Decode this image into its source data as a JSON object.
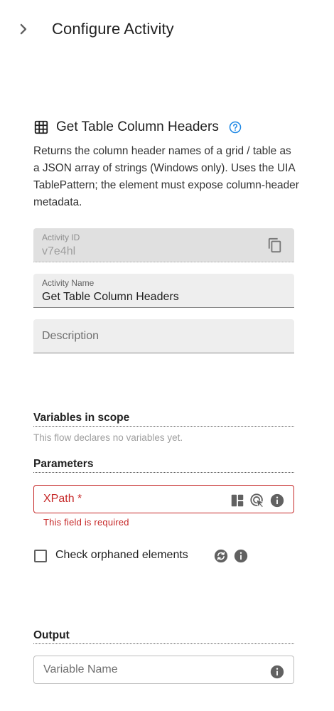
{
  "header": {
    "title": "Configure Activity",
    "back_icon": "chevron-right-icon"
  },
  "activity": {
    "icon": "table-icon",
    "title": "Get Table Column Headers",
    "help_icon": "help-circle-icon",
    "description": "Returns the column header names of a grid / table as a JSON array of strings (Windows only). Uses the UIA TablePattern; the element must expose column-header metadata."
  },
  "fields": {
    "activity_id": {
      "label": "Activity ID",
      "value": "v7e4hl"
    },
    "activity_name": {
      "label": "Activity Name",
      "value": "Get Table Column Headers"
    },
    "description": {
      "placeholder": "Description"
    }
  },
  "variables": {
    "heading": "Variables in scope",
    "empty_text": "This flow declares no variables yet."
  },
  "parameters": {
    "heading": "Parameters",
    "xpath": {
      "label": "XPath *",
      "error": "This field is required"
    },
    "orphaned": {
      "label": "Check orphaned elements",
      "checked": false
    }
  },
  "output": {
    "heading": "Output",
    "placeholder": "Variable Name"
  },
  "colors": {
    "error": "#c62828",
    "accent": "#1e88e5",
    "icon": "#616161"
  }
}
